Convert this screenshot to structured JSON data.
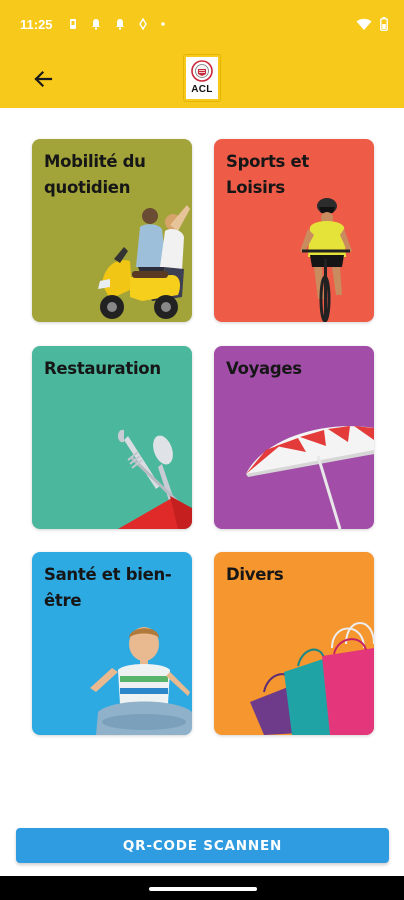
{
  "status_bar": {
    "time": "11:25",
    "notification_icons": [
      "sim-icon",
      "bell-icon",
      "bell-icon",
      "leaf-icon",
      "dot-icon"
    ],
    "system_icons": [
      "wifi-icon",
      "battery-icon"
    ]
  },
  "app_bar": {
    "back_icon": "arrow-left-icon",
    "logo_text": "ACL",
    "background": "#f7c91b"
  },
  "categories": [
    {
      "label": "Mobilité du quotidien",
      "color": "#a2a43a"
    },
    {
      "label": "Sports et Loisirs",
      "color": "#ee5c48"
    },
    {
      "label": "Restauration",
      "color": "#4bb79c"
    },
    {
      "label": "Voyages",
      "color": "#a24ea9"
    },
    {
      "label": "Santé et bien-être",
      "color": "#2eaae3"
    },
    {
      "label": "Divers",
      "color": "#f5962e"
    }
  ],
  "qr_button": {
    "label": "QR-CODE SCANNEN",
    "color": "#2f9be0"
  }
}
